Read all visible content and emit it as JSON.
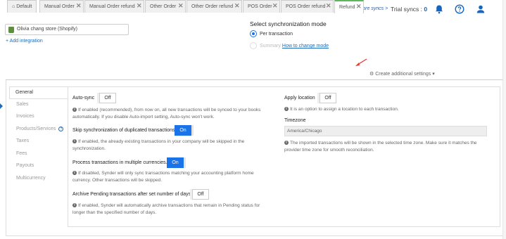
{
  "topbar": {
    "add_syncs": "Add more syncs >",
    "trial_label": "Trial syncs :",
    "trial_count": "0"
  },
  "store": {
    "name": "Olivia chang store (Shopify)"
  },
  "add_integration": "+ Add integration",
  "sync_mode": {
    "title": "Select synchronization mode",
    "per_transaction": "Per transaction",
    "summary": "Summary",
    "how_to_change": "How to change mode"
  },
  "tabs": [
    {
      "label": "Default",
      "closable": false
    },
    {
      "label": "Manual Order",
      "closable": true
    },
    {
      "label": "Manual Order refund",
      "closable": true
    },
    {
      "label": "Other Order",
      "closable": true
    },
    {
      "label": "Other Order refund",
      "closable": true
    },
    {
      "label": "POS Order",
      "closable": true
    },
    {
      "label": "POS Order refund",
      "closable": true
    },
    {
      "label": "Refund",
      "closable": true,
      "active": true
    }
  ],
  "create_more": "Create additional settings",
  "sidenav": [
    "General",
    "Sales",
    "Invoices",
    "Products/Services",
    "Taxes",
    "Fees",
    "Payouts",
    "Multicurrency"
  ],
  "settings": {
    "autosync": {
      "label": "Auto-sync",
      "state": "Off",
      "desc": "If enabled (recommended), from now on, all new transactions will be synced to your books automatically. If you disable Auto-import setting, Auto-sync won't work."
    },
    "skip_dup": {
      "label": "Skip synchronization of duplicated transactions",
      "state": "On",
      "desc": "If enabled, the already existing transactions in your company will be skipped in the synchronization."
    },
    "multi_currency": {
      "label": "Process transactions in multiple currencies.",
      "state": "On",
      "desc": "If disabled, Synder will only sync transactions matching your accounting platform home currency. Other transactions will be skipped."
    },
    "archive": {
      "label": "Archive Pending transactions after set number of days",
      "state": "Off",
      "desc": "If enabled, Synder will automatically archive transactions that remain in Pending status for longer than the specified number of days."
    },
    "apply_location": {
      "label": "Apply location",
      "state": "Off",
      "desc": "It is an option to assign a location to each transaction."
    },
    "timezone": {
      "label": "Timezone",
      "value": "America/Chicago",
      "desc": "The imported transactions will be shown in the selected time zone. Make sure it matches the provider time zone for smooth reconciliation."
    }
  },
  "colors": {
    "accent": "#1a73e8",
    "active_tab": "#5cb85c",
    "arrow": "#e53935"
  }
}
